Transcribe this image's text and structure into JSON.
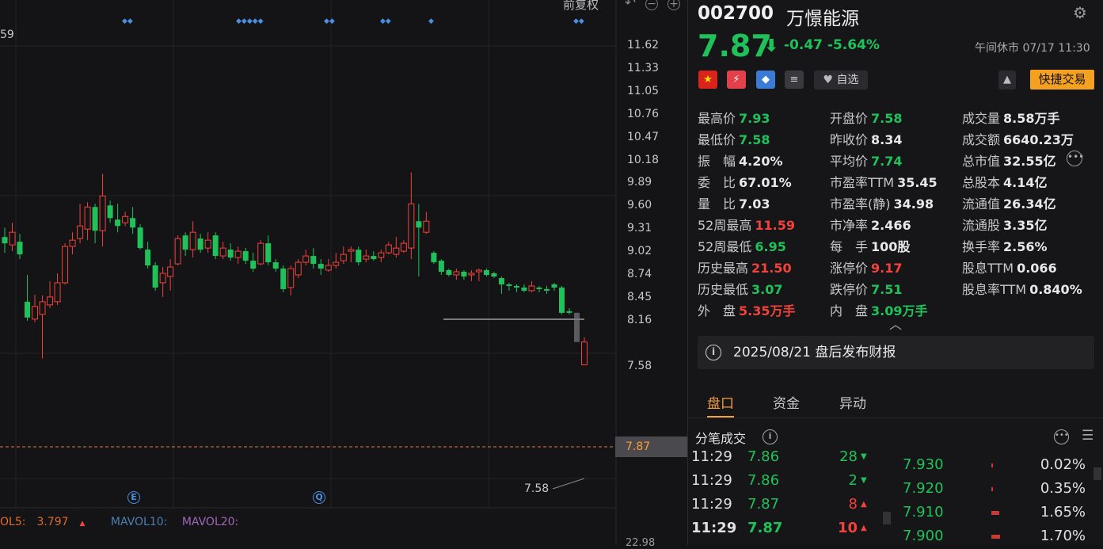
{
  "chart_toolbar": {
    "fuquan": "前复权",
    "undo_icon": "undo-icon",
    "zoom_out_icon": "zoom-out-icon",
    "zoom_in_icon": "zoom-in-icon"
  },
  "chart_data": {
    "type": "candlestick",
    "y_ticks": [
      "11.62",
      "11.33",
      "11.05",
      "10.76",
      "10.47",
      "10.18",
      "9.89",
      "9.60",
      "9.31",
      "9.02",
      "8.74",
      "8.45",
      "8.16",
      "7.87",
      "7.58"
    ],
    "current_price_label": "7.87",
    "period_high_label": "59",
    "period_low_label": "7.58",
    "candles": [
      {
        "o": 9.2,
        "c": 9.12,
        "h": 9.32,
        "l": 9.0
      },
      {
        "o": 9.1,
        "c": 9.26,
        "h": 9.38,
        "l": 9.02
      },
      {
        "o": 9.14,
        "c": 8.98,
        "h": 9.24,
        "l": 8.92
      },
      {
        "o": 8.38,
        "c": 8.18,
        "h": 8.72,
        "l": 8.14
      },
      {
        "o": 8.16,
        "c": 8.32,
        "h": 8.47,
        "l": 8.12
      },
      {
        "o": 8.22,
        "c": 8.38,
        "h": 8.46,
        "l": 7.66
      },
      {
        "o": 8.34,
        "c": 8.44,
        "h": 8.64,
        "l": 8.3
      },
      {
        "o": 8.38,
        "c": 8.62,
        "h": 8.74,
        "l": 8.34
      },
      {
        "o": 8.62,
        "c": 9.08,
        "h": 9.12,
        "l": 8.6
      },
      {
        "o": 9.08,
        "c": 9.16,
        "h": 9.26,
        "l": 8.98
      },
      {
        "o": 9.18,
        "c": 9.34,
        "h": 9.62,
        "l": 9.12
      },
      {
        "o": 9.3,
        "c": 9.58,
        "h": 9.64,
        "l": 9.16
      },
      {
        "o": 9.58,
        "c": 9.28,
        "h": 9.62,
        "l": 9.12
      },
      {
        "o": 9.28,
        "c": 9.72,
        "h": 10.0,
        "l": 9.08
      },
      {
        "o": 9.6,
        "c": 9.44,
        "h": 9.66,
        "l": 9.38
      },
      {
        "o": 9.42,
        "c": 9.34,
        "h": 9.62,
        "l": 9.26
      },
      {
        "o": 9.38,
        "c": 9.46,
        "h": 9.52,
        "l": 9.34
      },
      {
        "o": 9.44,
        "c": 9.32,
        "h": 9.58,
        "l": 9.24
      },
      {
        "o": 9.32,
        "c": 9.06,
        "h": 9.36,
        "l": 9.04
      },
      {
        "o": 9.04,
        "c": 8.84,
        "h": 9.14,
        "l": 8.8
      },
      {
        "o": 8.84,
        "c": 8.56,
        "h": 8.88,
        "l": 8.52
      },
      {
        "o": 8.62,
        "c": 8.74,
        "h": 8.82,
        "l": 8.44
      },
      {
        "o": 8.7,
        "c": 8.82,
        "h": 8.92,
        "l": 8.52
      },
      {
        "o": 8.86,
        "c": 9.18,
        "h": 9.22,
        "l": 8.84
      },
      {
        "o": 9.22,
        "c": 9.04,
        "h": 9.26,
        "l": 8.96
      },
      {
        "o": 9.04,
        "c": 9.26,
        "h": 9.4,
        "l": 8.94
      },
      {
        "o": 9.18,
        "c": 9.04,
        "h": 9.24,
        "l": 9.0
      },
      {
        "o": 9.06,
        "c": 9.16,
        "h": 9.26,
        "l": 9.0
      },
      {
        "o": 9.22,
        "c": 8.96,
        "h": 9.26,
        "l": 8.92
      },
      {
        "o": 8.96,
        "c": 9.06,
        "h": 9.14,
        "l": 8.92
      },
      {
        "o": 9.04,
        "c": 8.94,
        "h": 9.12,
        "l": 8.9
      },
      {
        "o": 8.94,
        "c": 9.02,
        "h": 9.08,
        "l": 8.86
      },
      {
        "o": 9.02,
        "c": 8.9,
        "h": 9.06,
        "l": 8.86
      },
      {
        "o": 8.9,
        "c": 8.8,
        "h": 9.0,
        "l": 8.76
      },
      {
        "o": 8.86,
        "c": 9.12,
        "h": 9.16,
        "l": 8.84
      },
      {
        "o": 9.12,
        "c": 8.88,
        "h": 9.22,
        "l": 8.84
      },
      {
        "o": 8.88,
        "c": 8.8,
        "h": 8.92,
        "l": 8.76
      },
      {
        "o": 8.8,
        "c": 8.54,
        "h": 8.84,
        "l": 8.5
      },
      {
        "o": 8.56,
        "c": 8.8,
        "h": 8.84,
        "l": 8.46
      },
      {
        "o": 8.72,
        "c": 8.88,
        "h": 8.92,
        "l": 8.68
      },
      {
        "o": 8.88,
        "c": 8.96,
        "h": 9.04,
        "l": 8.84
      },
      {
        "o": 8.96,
        "c": 8.86,
        "h": 9.06,
        "l": 8.8
      },
      {
        "o": 8.86,
        "c": 8.8,
        "h": 8.92,
        "l": 8.72
      },
      {
        "o": 8.78,
        "c": 8.84,
        "h": 8.92,
        "l": 8.76
      },
      {
        "o": 8.84,
        "c": 8.88,
        "h": 9.0,
        "l": 8.8
      },
      {
        "o": 8.9,
        "c": 8.98,
        "h": 9.08,
        "l": 8.86
      },
      {
        "o": 9.02,
        "c": 9.04,
        "h": 9.08,
        "l": 8.88
      },
      {
        "o": 9.04,
        "c": 8.88,
        "h": 9.08,
        "l": 8.84
      },
      {
        "o": 8.92,
        "c": 8.96,
        "h": 9.04,
        "l": 8.88
      },
      {
        "o": 8.96,
        "c": 8.92,
        "h": 9.02,
        "l": 8.9
      },
      {
        "o": 8.94,
        "c": 9.0,
        "h": 9.04,
        "l": 8.88
      },
      {
        "o": 9.0,
        "c": 9.1,
        "h": 9.14,
        "l": 8.98
      },
      {
        "o": 8.98,
        "c": 9.06,
        "h": 9.2,
        "l": 8.94
      },
      {
        "o": 9.02,
        "c": 9.12,
        "h": 9.16,
        "l": 9.0
      },
      {
        "o": 9.06,
        "c": 9.62,
        "h": 10.02,
        "l": 8.92
      },
      {
        "o": 9.4,
        "c": 9.32,
        "h": 9.62,
        "l": 8.7
      },
      {
        "o": 9.26,
        "c": 9.4,
        "h": 9.52,
        "l": 9.24
      },
      {
        "o": 9.0,
        "c": 8.88,
        "h": 9.02,
        "l": 8.86
      },
      {
        "o": 8.9,
        "c": 8.76,
        "h": 8.92,
        "l": 8.72
      },
      {
        "o": 8.78,
        "c": 8.72,
        "h": 8.8,
        "l": 8.7
      },
      {
        "o": 8.72,
        "c": 8.76,
        "h": 8.8,
        "l": 8.66
      },
      {
        "o": 8.76,
        "c": 8.7,
        "h": 8.78,
        "l": 8.66
      },
      {
        "o": 8.72,
        "c": 8.74,
        "h": 8.78,
        "l": 8.64
      },
      {
        "o": 8.76,
        "c": 8.78,
        "h": 8.8,
        "l": 8.64
      },
      {
        "o": 8.78,
        "c": 8.72,
        "h": 8.8,
        "l": 8.7
      },
      {
        "o": 8.74,
        "c": 8.7,
        "h": 8.76,
        "l": 8.68
      },
      {
        "o": 8.68,
        "c": 8.6,
        "h": 8.7,
        "l": 8.48
      },
      {
        "o": 8.6,
        "c": 8.58,
        "h": 8.62,
        "l": 8.52
      },
      {
        "o": 8.58,
        "c": 8.56,
        "h": 8.6,
        "l": 8.5
      },
      {
        "o": 8.56,
        "c": 8.52,
        "h": 8.6,
        "l": 8.5
      },
      {
        "o": 8.52,
        "c": 8.58,
        "h": 8.64,
        "l": 8.5
      },
      {
        "o": 8.56,
        "c": 8.54,
        "h": 8.58,
        "l": 8.5
      },
      {
        "o": 8.54,
        "c": 8.52,
        "h": 8.58,
        "l": 8.48
      },
      {
        "o": 8.6,
        "c": 8.56,
        "h": 8.62,
        "l": 8.52
      },
      {
        "o": 8.56,
        "c": 8.24,
        "h": 8.58,
        "l": 8.22
      },
      {
        "o": 8.26,
        "c": 8.24,
        "h": 8.3,
        "l": 8.22
      },
      {
        "o": 8.24,
        "c": 7.87,
        "h": 8.24,
        "l": 7.87
      },
      {
        "o": 7.58,
        "c": 7.87,
        "h": 7.93,
        "l": 7.58
      }
    ]
  },
  "volume_bar": {
    "vol5_label": "OL5:",
    "vol5_value": "3.797",
    "mavol10_label": "MAVOL10:",
    "mavol20_label": "MAVOL20:",
    "bottom_axis_value": "22.98"
  },
  "event_markers": {
    "e_marker": "E",
    "q_marker": "Q"
  },
  "stock": {
    "code": "002700",
    "name": "万憬能源",
    "price": "7.87",
    "change": "-0.47",
    "change_pct": "-5.64%",
    "status": "午间休市",
    "date_time": "07/17 11:30"
  },
  "action_bar": {
    "watch_label": "自选",
    "quick_trade_label": "快捷交易",
    "flag_icons": [
      "cn-flag-icon",
      "zap-icon",
      "tag-icon",
      "doc-icon"
    ],
    "flag_glyphs": [
      "★",
      "⚡",
      "◆",
      "≡"
    ],
    "bell_glyph": "▲"
  },
  "stats": [
    [
      {
        "k": "最高价",
        "v": "7.93",
        "c": "g"
      },
      {
        "k": "开盘价",
        "v": "7.58",
        "c": "g"
      },
      {
        "k": "成交量",
        "v": "8.58万手",
        "c": "w"
      }
    ],
    [
      {
        "k": "最低价",
        "v": "7.58",
        "c": "g"
      },
      {
        "k": "昨收价",
        "v": "8.34",
        "c": "w"
      },
      {
        "k": "成交额",
        "v": "6640.23万",
        "c": "w"
      }
    ],
    [
      {
        "k": "振　幅",
        "v": "4.20%",
        "c": "w"
      },
      {
        "k": "平均价",
        "v": "7.74",
        "c": "g"
      },
      {
        "k": "总市值",
        "v": "32.55亿",
        "c": "w"
      }
    ],
    [
      {
        "k": "委　比",
        "v": "67.01%",
        "c": "w"
      },
      {
        "k": "市盈率TTM",
        "v": "35.45",
        "c": "w"
      },
      {
        "k": "总股本",
        "v": "4.14亿",
        "c": "w"
      }
    ],
    [
      {
        "k": "量　比",
        "v": "7.03",
        "c": "w"
      },
      {
        "k": "市盈率(静)",
        "v": "34.98",
        "c": "w"
      },
      {
        "k": "流通值",
        "v": "26.34亿",
        "c": "w"
      }
    ],
    [
      {
        "k": "52周最高",
        "v": "11.59",
        "c": "r"
      },
      {
        "k": "市净率",
        "v": "2.466",
        "c": "w"
      },
      {
        "k": "流通股",
        "v": "3.35亿",
        "c": "w"
      }
    ],
    [
      {
        "k": "52周最低",
        "v": "6.95",
        "c": "g"
      },
      {
        "k": "每　手",
        "v": "100股",
        "c": "w"
      },
      {
        "k": "换手率",
        "v": "2.56%",
        "c": "w"
      }
    ],
    [
      {
        "k": "历史最高",
        "v": "21.50",
        "c": "r"
      },
      {
        "k": "涨停价",
        "v": "9.17",
        "c": "r"
      },
      {
        "k": "股息TTM",
        "v": "0.066",
        "c": "w"
      }
    ],
    [
      {
        "k": "历史最低",
        "v": "3.07",
        "c": "g"
      },
      {
        "k": "跌停价",
        "v": "7.51",
        "c": "g"
      },
      {
        "k": "股息率TTM",
        "v": "0.840%",
        "c": "w"
      }
    ],
    [
      {
        "k": "外　盘",
        "v": "5.35万手",
        "c": "r"
      },
      {
        "k": "内　盘",
        "v": "3.09万手",
        "c": "g"
      }
    ]
  ],
  "notice": {
    "text": "2025/08/21  盘后发布财报"
  },
  "tabs": [
    "盘口",
    "资金",
    "异动"
  ],
  "ticks": {
    "title": "分笔成交",
    "rows": [
      {
        "t": "11:29",
        "p": "7.86",
        "n": "28",
        "dir": "down"
      },
      {
        "t": "11:29",
        "p": "7.86",
        "n": "2",
        "dir": "down"
      },
      {
        "t": "11:29",
        "p": "7.87",
        "n": "8",
        "dir": "up"
      },
      {
        "t": "11:29",
        "p": "7.87",
        "n": "10",
        "dir": "up"
      }
    ]
  },
  "depth": {
    "rows": [
      {
        "p": "7.930",
        "pct": "0.02%",
        "frac": 0.01
      },
      {
        "p": "7.920",
        "pct": "0.35%",
        "frac": 0.02
      },
      {
        "p": "7.910",
        "pct": "1.65%",
        "frac": 0.1
      },
      {
        "p": "7.900",
        "pct": "1.70%",
        "frac": 0.11
      }
    ]
  },
  "colors": {
    "up": "#f2423b",
    "down": "#1fc25a",
    "accent": "#f2a040"
  }
}
